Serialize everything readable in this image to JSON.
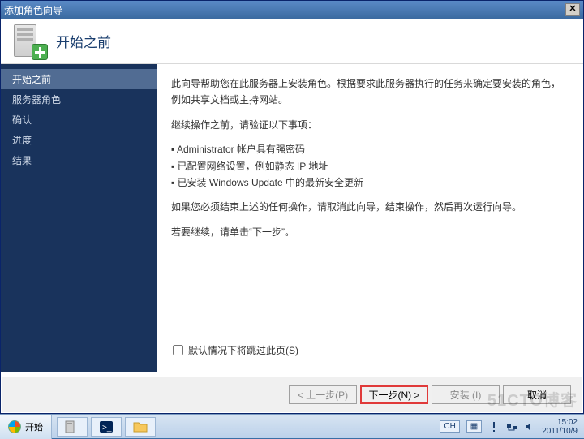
{
  "window": {
    "title": "添加角色向导",
    "close_glyph": "✕"
  },
  "header": {
    "title": "开始之前"
  },
  "sidebar": {
    "items": [
      {
        "label": "开始之前",
        "selected": true
      },
      {
        "label": "服务器角色",
        "selected": false
      },
      {
        "label": "确认",
        "selected": false
      },
      {
        "label": "进度",
        "selected": false
      },
      {
        "label": "结果",
        "selected": false
      }
    ]
  },
  "content": {
    "intro": "此向导帮助您在此服务器上安装角色。根据要求此服务器执行的任务来确定要安装的角色，例如共享文档或主持网站。",
    "verify_heading": "继续操作之前，请验证以下事项：",
    "bullets": [
      "Administrator 帐户具有强密码",
      "已配置网络设置，例如静态 IP 地址",
      "已安装 Windows Update 中的最新安全更新"
    ],
    "cancel_note": "如果您必须结束上述的任何操作，请取消此向导，结束操作，然后再次运行向导。",
    "continue_note": "若要继续，请单击“下一步”。"
  },
  "skip": {
    "label": "默认情况下将跳过此页(S)"
  },
  "footer": {
    "prev": "< 上一步(P)",
    "next": "下一步(N) >",
    "install": "安装 (I)",
    "cancel": "取消"
  },
  "taskbar": {
    "start": "开始",
    "lang1": "CH",
    "lang2": "▦",
    "time": "15:02",
    "date": "2011/10/9"
  },
  "watermark": "51CTO博客"
}
